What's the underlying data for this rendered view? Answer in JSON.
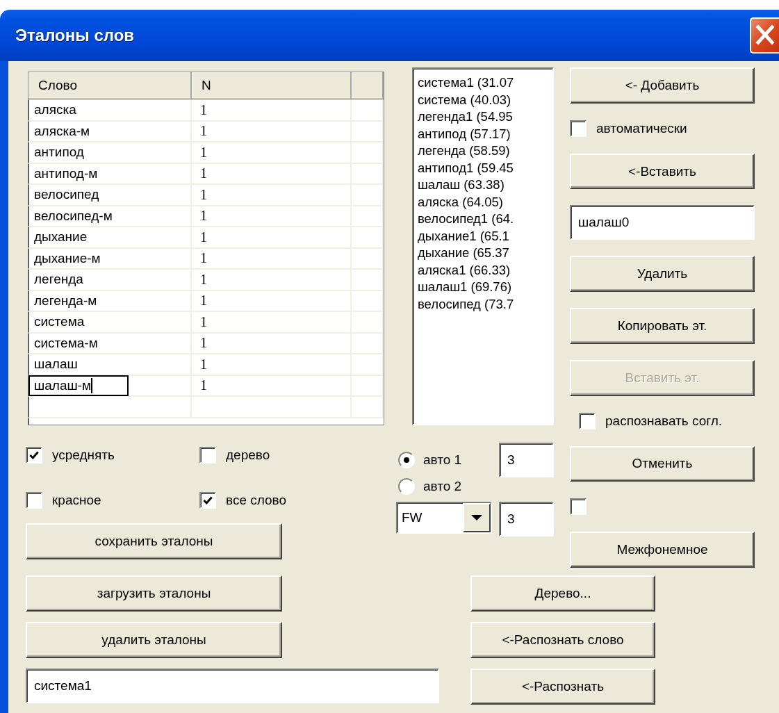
{
  "window": {
    "title": "Эталоны слов"
  },
  "word_table": {
    "columns": [
      "Слово",
      "N",
      ""
    ],
    "rows": [
      {
        "word": "аляска",
        "n": "1",
        "editing": false
      },
      {
        "word": "аляска-м",
        "n": "1",
        "editing": false
      },
      {
        "word": "антипод",
        "n": "1",
        "editing": false
      },
      {
        "word": "антипод-м",
        "n": "1",
        "editing": false
      },
      {
        "word": "велосипед",
        "n": "1",
        "editing": false
      },
      {
        "word": "велосипед-м",
        "n": "1",
        "editing": false
      },
      {
        "word": "дыхание",
        "n": "1",
        "editing": false
      },
      {
        "word": "дыхание-м",
        "n": "1",
        "editing": false
      },
      {
        "word": "легенда",
        "n": "1",
        "editing": false
      },
      {
        "word": "легенда-м",
        "n": "1",
        "editing": false
      },
      {
        "word": "система",
        "n": "1",
        "editing": false
      },
      {
        "word": "система-м",
        "n": "1",
        "editing": false
      },
      {
        "word": "шалаш",
        "n": "1",
        "editing": false
      },
      {
        "word": "шалаш-м",
        "n": "1",
        "editing": true
      }
    ]
  },
  "options": [
    {
      "label": "усреднять",
      "checked": true
    },
    {
      "label": "дерево",
      "checked": false
    },
    {
      "label": "красное",
      "checked": false
    },
    {
      "label": "все слово",
      "checked": true
    }
  ],
  "file_buttons": [
    "сохранить эталоны",
    "загрузить эталоны",
    "удалить эталоны"
  ],
  "result_field": {
    "value": "система1"
  },
  "results_list": {
    "items": [
      "система1 (31.07",
      "система (40.03)",
      "легенда1 (54.95",
      "антипод (57.17)",
      "легенда (58.59)",
      "антипод1 (59.45",
      "шалаш (63.38)",
      "аляска (64.05)",
      "велосипед1 (64.",
      "дыхание1 (65.1",
      "дыхание (65.37",
      "аляска1 (66.33)",
      "шалаш1 (69.76)",
      "велосипед (73.7"
    ]
  },
  "modes": [
    {
      "label": "авто 1",
      "selected": true,
      "value": "3"
    },
    {
      "label": "авто 2",
      "selected": false
    }
  ],
  "method": {
    "combo": "FW",
    "value": "3"
  },
  "right_controls": [
    {
      "kind": "button",
      "label": "<- Добавить",
      "disabled": false
    },
    {
      "kind": "checkbox",
      "label": "автоматически",
      "checked": false
    },
    {
      "kind": "button",
      "label": "<-Вставить",
      "disabled": false
    },
    {
      "kind": "field",
      "value": "шалаш0"
    },
    {
      "kind": "button",
      "label": "Удалить",
      "disabled": false
    },
    {
      "kind": "button",
      "label": "Копировать эт.",
      "disabled": false
    },
    {
      "kind": "button",
      "label": "Вставить эт.",
      "disabled": true
    },
    {
      "kind": "checkbox",
      "label": "распознавать согл.",
      "checked": false
    },
    {
      "kind": "button",
      "label": "Отменить",
      "disabled": false
    },
    {
      "kind": "checkbox",
      "checked": false
    },
    {
      "kind": "button",
      "label": "Межфонемное",
      "disabled": false
    }
  ],
  "recognize_buttons": [
    "Дерево...",
    "<-Распознать слово",
    "<-Распознать"
  ]
}
